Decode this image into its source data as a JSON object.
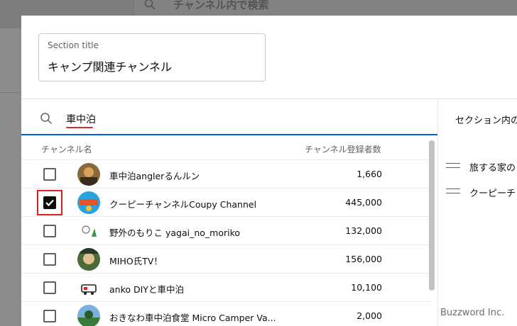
{
  "background": {
    "search_placeholder": "チャンネル内で検索"
  },
  "dialog": {
    "section_title": {
      "label": "Section title",
      "value": "キャンプ関連チャンネル"
    },
    "search": {
      "value": "車中泊"
    },
    "right_panel": {
      "tab_label": "セクション内の",
      "items": [
        {
          "label": "旅する家の"
        },
        {
          "label": "クーピーチ"
        }
      ]
    },
    "columns": {
      "name": "チャンネル名",
      "subscribers": "チャンネル登録者数"
    },
    "channels": [
      {
        "name": "車中泊anglerるんルン",
        "subscribers": "1,660",
        "checked": false,
        "avatar_color": "#8a6a3a"
      },
      {
        "name": "クーピーチャンネルCoupy Channel",
        "subscribers": "445,000",
        "checked": true,
        "avatar_color": "#29a3e0"
      },
      {
        "name": "野外のもりこ yagai_no_moriko",
        "subscribers": "132,000",
        "checked": false,
        "avatar_color": "#ffffff"
      },
      {
        "name": "MIHO氏TV！",
        "subscribers": "156,000",
        "checked": false,
        "avatar_color": "#4a6a3a"
      },
      {
        "name": "anko DIYと車中泊",
        "subscribers": "10,100",
        "checked": false,
        "avatar_color": "#ffffff"
      },
      {
        "name": "おきなわ車中泊食堂 Micro Camper Va...",
        "subscribers": "2,000",
        "checked": false,
        "avatar_color": "#5a8ac0"
      }
    ]
  },
  "watermark": "Buzzword Inc.",
  "colors": {
    "accent": "#065fd4",
    "focus": "#e02020",
    "spellcheck": "#d32f2f"
  }
}
